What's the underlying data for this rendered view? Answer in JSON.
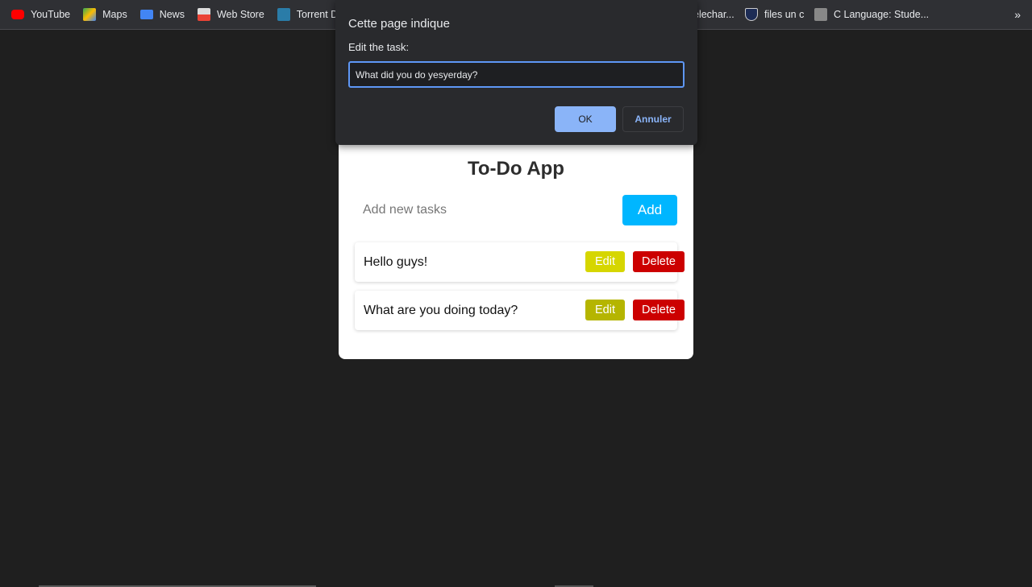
{
  "bookmarks": [
    {
      "label": "YouTube",
      "icon": "youtube-icon",
      "color": "#ff0000"
    },
    {
      "label": "Maps",
      "icon": "maps-icon",
      "color": "#34a853"
    },
    {
      "label": "News",
      "icon": "news-icon",
      "color": "#4285f4"
    },
    {
      "label": "Web Store",
      "icon": "webstore-icon",
      "color": "#dddddd"
    },
    {
      "label": "Torrent De",
      "icon": "torrent-icon",
      "color": "#2a7ca8"
    },
    {
      "label": "elechar...",
      "icon": "bookmark-icon",
      "color": "#555555"
    },
    {
      "label": "files un c",
      "icon": "shield-icon",
      "color": "#1d2c55"
    },
    {
      "label": "C Language: Stude...",
      "icon": "avatar-icon",
      "color": "#777777"
    }
  ],
  "bookmarks_more": "»",
  "app": {
    "title": "To-Do App",
    "input_placeholder": "Add new tasks",
    "add_label": "Add",
    "tasks": [
      {
        "text": "Hello guys!",
        "edit_label": "Edit",
        "delete_label": "Delete",
        "edit_color": "#d6d600"
      },
      {
        "text": "What are you doing today?",
        "edit_label": "Edit",
        "delete_label": "Delete",
        "edit_color": "#b5b500"
      }
    ]
  },
  "dialog": {
    "title": "Cette page indique",
    "message": "Edit the task:",
    "input_value": "What did you do yesyerday?",
    "ok_label": "OK",
    "cancel_label": "Annuler"
  }
}
